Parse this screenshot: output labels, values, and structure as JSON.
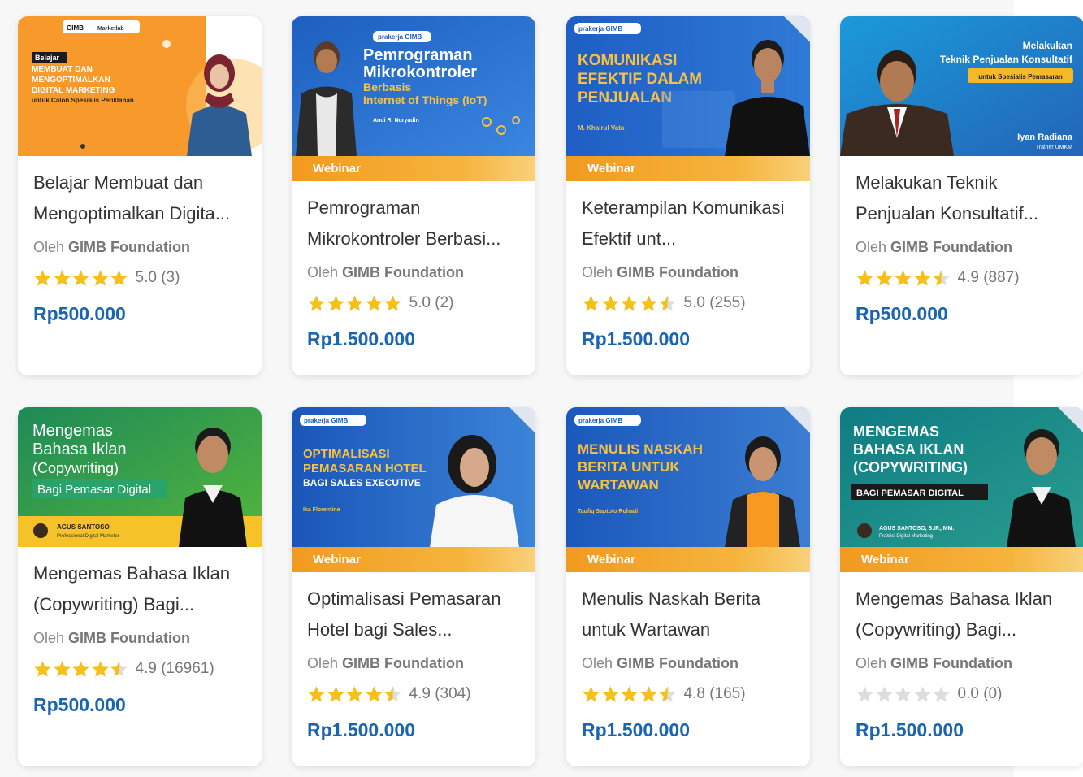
{
  "author_prefix": "Oleh",
  "cards": [
    {
      "title": "Belajar Membuat dan Mengoptimalkan Digita...",
      "author": "GIMB Foundation",
      "rating_text": "5.0 (3)",
      "rating": 5.0,
      "price": "Rp500.000",
      "badge": "",
      "thumb": {
        "brand_left": "GIMB",
        "brand_right": "Marketlab",
        "tag": "Belajar",
        "lines": [
          "MEMBUAT DAN",
          "MENGOPTIMALKAN",
          "DIGITAL MARKETING"
        ],
        "sub": "untuk Calon Spesialis Periklanan"
      }
    },
    {
      "title": "Pemrograman Mikrokontroler Berbasi...",
      "author": "GIMB Foundation",
      "rating_text": "5.0 (2)",
      "rating": 5.0,
      "price": "Rp1.500.000",
      "badge": "Webinar",
      "thumb": {
        "brand": "prakerja GIMB",
        "lines": [
          "Pemrograman",
          "Mikrokontroler"
        ],
        "sub1": "Berbasis",
        "sub2": "Internet of Things (IoT)",
        "person": "Andi R. Nuryadin"
      }
    },
    {
      "title": "Keterampilan Komunikasi Efektif unt...",
      "author": "GIMB Foundation",
      "rating_text": "5.0 (255)",
      "rating": 4.5,
      "price": "Rp1.500.000",
      "badge": "Webinar",
      "thumb": {
        "brand": "prakerja GIMB",
        "lines": [
          "KOMUNIKASI",
          "EFEKTIF DALAM",
          "PENJUALAN"
        ],
        "person": "M. Khairul Vata"
      }
    },
    {
      "title": "Melakukan Teknik Penjualan Konsultatif...",
      "author": "GIMB Foundation",
      "rating_text": "4.9 (887)",
      "rating": 4.5,
      "price": "Rp500.000",
      "badge": "",
      "thumb": {
        "line1": "Melakukan",
        "line2": "Teknik Penjualan Konsultatif",
        "pill": "untuk Spesialis Pemasaran",
        "person": "Iyan Radiana",
        "role": "Trainer UMKM"
      }
    },
    {
      "title": "Mengemas Bahasa Iklan (Copywriting) Bagi...",
      "author": "GIMB Foundation",
      "rating_text": "4.9 (16961)",
      "rating": 4.5,
      "price": "Rp500.000",
      "badge": "",
      "thumb": {
        "lines": [
          "Mengemas",
          "Bahasa Iklan",
          "(Copywriting)"
        ],
        "pill": "Bagi Pemasar Digital",
        "person": "AGUS SANTOSO",
        "role": "Professional Digital Marketer"
      }
    },
    {
      "title": "Optimalisasi Pemasaran Hotel bagi Sales...",
      "author": "GIMB Foundation",
      "rating_text": "4.9 (304)",
      "rating": 4.5,
      "price": "Rp1.500.000",
      "badge": "Webinar",
      "thumb": {
        "brand": "prakerja GIMB",
        "lines": [
          "OPTIMALISASI",
          "PEMASARAN HOTEL"
        ],
        "sub": "BAGI SALES EXECUTIVE",
        "person": "Ika Florentina"
      }
    },
    {
      "title": "Menulis Naskah Berita untuk Wartawan",
      "author": "GIMB Foundation",
      "rating_text": "4.8 (165)",
      "rating": 4.5,
      "price": "Rp1.500.000",
      "badge": "Webinar",
      "thumb": {
        "brand": "prakerja GIMB",
        "lines": [
          "MENULIS NASKAH",
          "BERITA UNTUK",
          "WARTAWAN"
        ],
        "person": "Taufiq Saptoto Rohadi"
      }
    },
    {
      "title": "Mengemas Bahasa Iklan (Copywriting) Bagi...",
      "author": "GIMB Foundation",
      "rating_text": "0.0 (0)",
      "rating": 0,
      "price": "Rp1.500.000",
      "badge": "Webinar",
      "thumb": {
        "lines": [
          "MENGEMAS",
          "BAHASA IKLAN",
          "(COPYWRITING)"
        ],
        "pill": "BAGI PEMASAR DIGITAL",
        "person": "AGUS SANTOSO, S.IP., MM.",
        "role": "Praktisi Digital Marketing"
      }
    }
  ],
  "colors": {
    "price": "#1a65b0",
    "star_on": "#f5c01a",
    "star_off": "#dddddd",
    "badge": "#f19a1f"
  }
}
